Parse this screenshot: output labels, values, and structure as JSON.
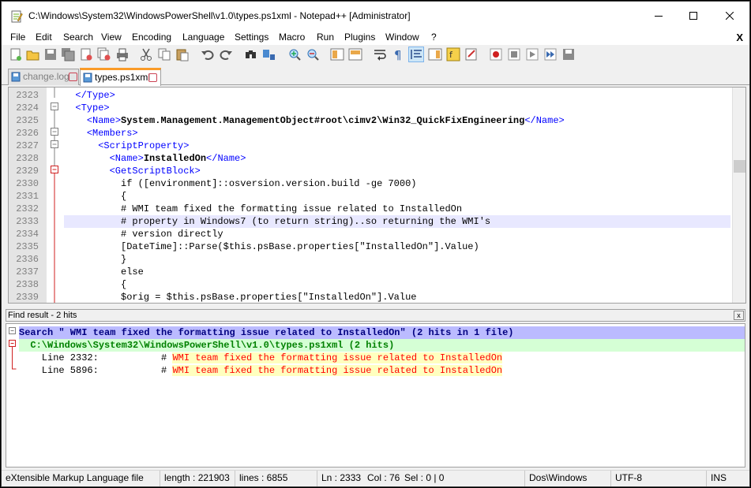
{
  "window": {
    "title": "C:\\Windows\\System32\\WindowsPowerShell\\v1.0\\types.ps1xml - Notepad++ [Administrator]",
    "minimize_icon": "minimize-icon",
    "maximize_icon": "maximize-icon",
    "close_icon": "close-icon"
  },
  "menu": {
    "items": [
      "File",
      "Edit",
      "Search",
      "View",
      "Encoding",
      "Language",
      "Settings",
      "Macro",
      "Run",
      "Plugins",
      "Window",
      "?"
    ],
    "close_doc": "X"
  },
  "toolbar": {
    "icons": [
      "new-file-icon",
      "open-file-icon",
      "save-icon",
      "save-all-icon",
      "close-icon",
      "close-all-icon",
      "print-icon",
      "cut-icon",
      "copy-icon",
      "paste-icon",
      "undo-icon",
      "redo-icon",
      "find-icon",
      "replace-icon",
      "zoom-in-icon",
      "zoom-out-icon",
      "sync-vertical-icon",
      "sync-horizontal-icon",
      "word-wrap-icon",
      "show-all-chars-icon",
      "indent-guide-icon",
      "doc-map-icon",
      "function-list-icon",
      "folder-workspace-icon",
      "record-macro-icon",
      "stop-macro-icon",
      "play-macro-icon",
      "play-multiple-macro-icon",
      "save-macro-icon"
    ]
  },
  "tabs": [
    {
      "label": "change.log",
      "active": false
    },
    {
      "label": "types.ps1xml",
      "active": true
    }
  ],
  "editor": {
    "current_line": 2333,
    "lines": [
      {
        "num": "2323",
        "indent": "  ",
        "tag_open": "</Type>",
        "text": "",
        "tag_close": ""
      },
      {
        "num": "2324",
        "indent": "  ",
        "tag_open": "<Type>",
        "text": "",
        "tag_close": ""
      },
      {
        "num": "2325",
        "indent": "    ",
        "tag_open": "<Name>",
        "text": "System.Management.ManagementObject#root\\cimv2\\Win32_QuickFixEngineering",
        "tag_close": "</Name>"
      },
      {
        "num": "2326",
        "indent": "    ",
        "tag_open": "<Members>",
        "text": "",
        "tag_close": ""
      },
      {
        "num": "2327",
        "indent": "      ",
        "tag_open": "<ScriptProperty>",
        "text": "",
        "tag_close": ""
      },
      {
        "num": "2328",
        "indent": "        ",
        "tag_open": "<Name>",
        "text": "InstalledOn",
        "tag_close": "</Name>"
      },
      {
        "num": "2329",
        "indent": "        ",
        "tag_open": "<GetScriptBlock>",
        "text": "",
        "tag_close": ""
      },
      {
        "num": "2330",
        "indent": "          ",
        "tag_open": "",
        "text": "if ([environment]::osversion.version.build -ge 7000)",
        "tag_close": ""
      },
      {
        "num": "2331",
        "indent": "          ",
        "tag_open": "",
        "text": "{",
        "tag_close": ""
      },
      {
        "num": "2332",
        "indent": "          ",
        "tag_open": "",
        "text": "# WMI team fixed the formatting issue related to InstalledOn",
        "tag_close": ""
      },
      {
        "num": "2333",
        "indent": "          ",
        "tag_open": "",
        "text": "# property in Windows7 (to return string)..so returning the WMI's",
        "tag_close": ""
      },
      {
        "num": "2334",
        "indent": "          ",
        "tag_open": "",
        "text": "# version directly",
        "tag_close": ""
      },
      {
        "num": "2335",
        "indent": "          ",
        "tag_open": "",
        "text": "[DateTime]::Parse($this.psBase.properties[\"InstalledOn\"].Value)",
        "tag_close": ""
      },
      {
        "num": "2336",
        "indent": "          ",
        "tag_open": "",
        "text": "}",
        "tag_close": ""
      },
      {
        "num": "2337",
        "indent": "          ",
        "tag_open": "",
        "text": "else",
        "tag_close": ""
      },
      {
        "num": "2338",
        "indent": "          ",
        "tag_open": "",
        "text": "{",
        "tag_close": ""
      },
      {
        "num": "2339",
        "indent": "          ",
        "tag_open": "",
        "text": "$orig = $this.psBase.properties[\"InstalledOn\"].Value",
        "tag_close": ""
      }
    ]
  },
  "find_result": {
    "title": "Find result - 2 hits",
    "close": "x",
    "search_line": "Search \" WMI team fixed the formatting issue related to InstalledOn\" (2 hits in 1 file)",
    "file_line": "  C:\\Windows\\System32\\WindowsPowerShell\\v1.0\\types.ps1xml (2 hits)",
    "hits": [
      {
        "prefix": "    Line 2332:           # ",
        "match": "WMI team fixed the formatting issue related to InstalledOn"
      },
      {
        "prefix": "    Line 5896:           # ",
        "match": "WMI team fixed the formatting issue related to InstalledOn"
      }
    ]
  },
  "status": {
    "type": "eXtensible Markup Language file",
    "length": "length : 221903",
    "lines": "lines : 6855",
    "ln": "Ln : 2333",
    "col": "Col : 76",
    "sel": "Sel : 0 | 0",
    "eol": "Dos\\Windows",
    "encoding": "UTF-8",
    "mode": "INS"
  }
}
